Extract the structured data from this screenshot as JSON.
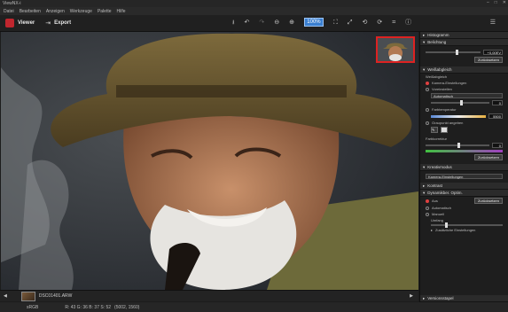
{
  "window": {
    "title": "ViewNX-i",
    "controls": [
      "–",
      "□",
      "✕"
    ]
  },
  "menu": [
    "Datei",
    "Bearbeiten",
    "Anzeigen",
    "Werkzeuge",
    "Palette",
    "Hilfe"
  ],
  "toolbar": {
    "viewer_label": "Viewer",
    "export_label": "Export",
    "zoom_value": "100%"
  },
  "filmstrip": {
    "filename": "DSC01401.ARW"
  },
  "status": {
    "colorspace": "sRGB",
    "readout": "R: 43  G: 36  B: 37  S: 52",
    "coords": "(5002, 1560)"
  },
  "panel": {
    "histogram": "Histogramm",
    "exposure": {
      "title": "Belichtung",
      "value": "+0,00EV",
      "reset": "Zurücksetzen"
    },
    "wb": {
      "title": "Weißabgleich",
      "sub": "Weißabgleich",
      "options": [
        "Kamera-Einstellungen",
        "Voreinstellen",
        "Farbtemperatur",
        "Graupunkt angeben"
      ],
      "preset_select": "Automatisch",
      "temp_value": "0",
      "kelvin_value": "5500",
      "tint_label": "Farbkorrektur",
      "tint_value": "0",
      "reset": "Zurücksetzen"
    },
    "picture_control": {
      "title": "Kreativmodus",
      "select": "Kamera-Einstellungen"
    },
    "contrast": {
      "title": "Kontrast"
    },
    "dlighting": {
      "title": "Dynamikber. Optim.",
      "options": [
        "Aus",
        "Automatisch",
        "Manuell"
      ],
      "reset": "Zurücksetzen",
      "amount_label": "Umfang",
      "extra_label": "Zusätzliche Einstellungen"
    },
    "version": "Versionsstapel"
  },
  "colors": {
    "accent": "#c0262e",
    "zoom_highlight": "#3a7fd0"
  }
}
